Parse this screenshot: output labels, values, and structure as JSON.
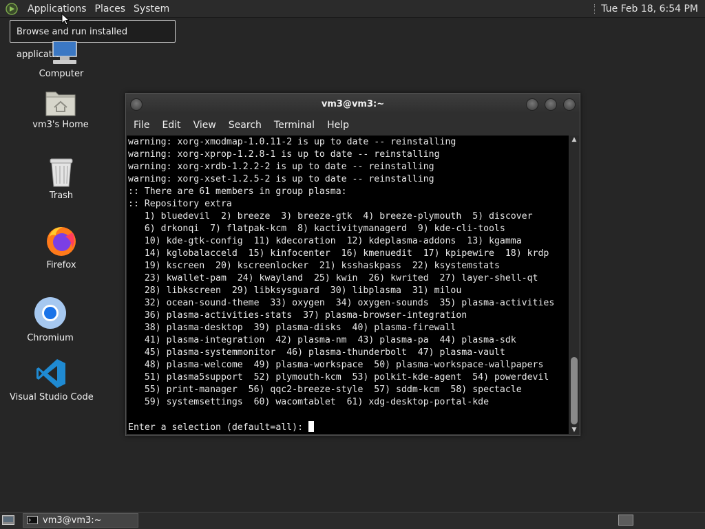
{
  "top_panel": {
    "menus": [
      "Applications",
      "Places",
      "System"
    ],
    "clock": "Tue Feb 18,  6:54 PM"
  },
  "tooltip": "Browse and run installed applications",
  "desktop_icons": {
    "computer": "Computer",
    "home": "vm3's Home",
    "trash": "Trash",
    "firefox": "Firefox",
    "chromium": "Chromium",
    "vscode": "Visual Studio Code"
  },
  "terminal": {
    "title": "vm3@vm3:~",
    "menus": [
      "File",
      "Edit",
      "View",
      "Search",
      "Terminal",
      "Help"
    ],
    "lines": [
      "warning: xorg-xmodmap-1.0.11-2 is up to date -- reinstalling",
      "warning: xorg-xprop-1.2.8-1 is up to date -- reinstalling",
      "warning: xorg-xrdb-1.2.2-2 is up to date -- reinstalling",
      "warning: xorg-xset-1.2.5-2 is up to date -- reinstalling",
      ":: There are 61 members in group plasma:",
      ":: Repository extra",
      "   1) bluedevil  2) breeze  3) breeze-gtk  4) breeze-plymouth  5) discover",
      "   6) drkonqi  7) flatpak-kcm  8) kactivitymanagerd  9) kde-cli-tools",
      "   10) kde-gtk-config  11) kdecoration  12) kdeplasma-addons  13) kgamma",
      "   14) kglobalacceld  15) kinfocenter  16) kmenuedit  17) kpipewire  18) krdp",
      "   19) kscreen  20) kscreenlocker  21) ksshaskpass  22) ksystemstats",
      "   23) kwallet-pam  24) kwayland  25) kwin  26) kwrited  27) layer-shell-qt",
      "   28) libkscreen  29) libksysguard  30) libplasma  31) milou",
      "   32) ocean-sound-theme  33) oxygen  34) oxygen-sounds  35) plasma-activities",
      "   36) plasma-activities-stats  37) plasma-browser-integration",
      "   38) plasma-desktop  39) plasma-disks  40) plasma-firewall",
      "   41) plasma-integration  42) plasma-nm  43) plasma-pa  44) plasma-sdk",
      "   45) plasma-systemmonitor  46) plasma-thunderbolt  47) plasma-vault",
      "   48) plasma-welcome  49) plasma-workspace  50) plasma-workspace-wallpapers",
      "   51) plasma5support  52) plymouth-kcm  53) polkit-kde-agent  54) powerdevil",
      "   55) print-manager  56) qqc2-breeze-style  57) sddm-kcm  58) spectacle",
      "   59) systemsettings  60) wacomtablet  61) xdg-desktop-portal-kde",
      "",
      "Enter a selection (default=all): "
    ]
  },
  "taskbar": {
    "window_label": "vm3@vm3:~"
  }
}
